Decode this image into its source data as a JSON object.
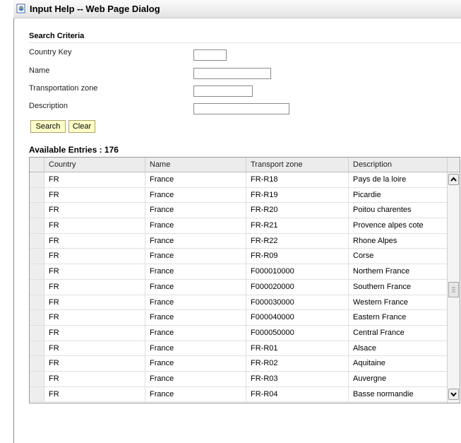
{
  "window": {
    "title": "Input Help -- Web Page Dialog"
  },
  "criteria": {
    "heading": "Search Criteria",
    "fields": [
      {
        "label": "Country Key",
        "value": ""
      },
      {
        "label": "Name",
        "value": ""
      },
      {
        "label": "Transportation zone",
        "value": ""
      },
      {
        "label": "Description",
        "value": ""
      }
    ],
    "search_label": "Search",
    "clear_label": "Clear"
  },
  "results": {
    "heading": "Available Entries : 176",
    "columns": [
      "Country",
      "Name",
      "Transport zone",
      "Description"
    ],
    "rows": [
      [
        "FR",
        "France",
        "FR-R18",
        "Pays de la loire"
      ],
      [
        "FR",
        "France",
        "FR-R19",
        "Picardie"
      ],
      [
        "FR",
        "France",
        "FR-R20",
        "Poitou charentes"
      ],
      [
        "FR",
        "France",
        "FR-R21",
        "Provence alpes cote"
      ],
      [
        "FR",
        "France",
        "FR-R22",
        "Rhone Alpes"
      ],
      [
        "FR",
        "France",
        "FR-R09",
        "Corse"
      ],
      [
        "FR",
        "France",
        "F000010000",
        "Northern France"
      ],
      [
        "FR",
        "France",
        "F000020000",
        "Southern France"
      ],
      [
        "FR",
        "France",
        "F000030000",
        "Western France"
      ],
      [
        "FR",
        "France",
        "F000040000",
        "Eastern France"
      ],
      [
        "FR",
        "France",
        "F000050000",
        "Central France"
      ],
      [
        "FR",
        "France",
        "FR-R01",
        "Alsace"
      ],
      [
        "FR",
        "France",
        "FR-R02",
        "Aquitaine"
      ],
      [
        "FR",
        "France",
        "FR-R03",
        "Auvergne"
      ],
      [
        "FR",
        "France",
        "FR-R04",
        "Basse normandie"
      ]
    ]
  },
  "icons": {
    "window": "ie-page-icon",
    "scroll_up": "chevron-up-icon",
    "scroll_down": "chevron-down-icon"
  }
}
